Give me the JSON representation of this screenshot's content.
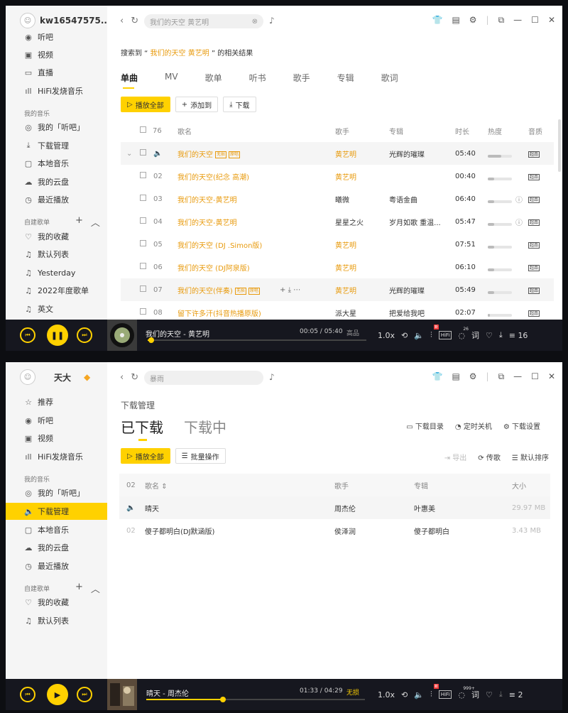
{
  "window1": {
    "user": {
      "name": "kw16547575...",
      "vip_icon": "diamond-icon"
    },
    "search": {
      "value": "我们的天空 黄艺明"
    },
    "sidebar": {
      "top_items": [
        {
          "label": "听吧",
          "icon": "radio-icon"
        },
        {
          "label": "视频",
          "icon": "video-icon"
        },
        {
          "label": "直播",
          "icon": "live-icon"
        },
        {
          "label": "HiFi发烧音乐",
          "icon": "hifi-icon"
        }
      ],
      "my_music_heading": "我的音乐",
      "my_items": [
        {
          "label": "我的「听吧」",
          "icon": "ear-icon"
        },
        {
          "label": "下载管理",
          "icon": "download-icon"
        },
        {
          "label": "本地音乐",
          "icon": "monitor-icon"
        },
        {
          "label": "我的云盘",
          "icon": "cloud-icon"
        },
        {
          "label": "最近播放",
          "icon": "clock-icon"
        }
      ],
      "playlists_heading": "自建歌单",
      "playlists": [
        {
          "label": "我的收藏",
          "icon": "heart-icon"
        },
        {
          "label": "默认列表",
          "icon": "playlist-icon"
        },
        {
          "label": "Yesterday",
          "icon": "playlist-icon"
        },
        {
          "label": "2022年度歌单",
          "icon": "playlist-icon"
        },
        {
          "label": "英文",
          "icon": "playlist-icon"
        }
      ]
    },
    "result": {
      "prefix": "搜索到 “ ",
      "query": "我们的天空 黄艺明",
      "suffix": " ” 的相关结果"
    },
    "tabs": [
      "单曲",
      "MV",
      "歌单",
      "听书",
      "歌手",
      "专辑",
      "歌词"
    ],
    "active_tab": "单曲",
    "buttons": {
      "play_all": "播放全部",
      "add_to": "添加到",
      "download": "下载"
    },
    "table": {
      "count": "76",
      "headers": {
        "song": "歌名",
        "artist": "歌手",
        "album": "专辑",
        "duration": "时长",
        "heat": "热度",
        "quality": "音质"
      },
      "rows": [
        {
          "num": "",
          "title": "我们的天空",
          "tags": [
            "无损",
            "原唱"
          ],
          "artist": "黄艺明",
          "artist_link": true,
          "album": "光辉的璀璨",
          "duration": "05:40",
          "heat": 0.55,
          "playing": true
        },
        {
          "num": "02",
          "title": "我们的天空(纪念 高潮)",
          "tags": [],
          "artist": "黄艺明",
          "artist_link": true,
          "album": "",
          "duration": "00:40",
          "heat": 0.25
        },
        {
          "num": "03",
          "title": "我们的天空-黄艺明",
          "tags": [],
          "artist": "曦微",
          "artist_link": false,
          "album": "粤语金曲",
          "duration": "06:40",
          "heat": 0.25
        },
        {
          "num": "04",
          "title": "我们的天空-黄艺明",
          "tags": [],
          "artist": "星星之火",
          "artist_link": false,
          "album": "岁月如歌 重温...",
          "duration": "05:47",
          "heat": 0.25
        },
        {
          "num": "05",
          "title": "我们的天空 (DJ .Simon版)",
          "tags": [],
          "artist": "黄艺明",
          "artist_link": true,
          "album": "",
          "duration": "07:51",
          "heat": 0.25
        },
        {
          "num": "06",
          "title": "我们的天空 (DJ阿泉版)",
          "tags": [],
          "artist": "黄艺明",
          "artist_link": true,
          "album": "",
          "duration": "06:10",
          "heat": 0.25
        },
        {
          "num": "07",
          "title": "我们的天空(伴奏)",
          "tags": [
            "无损",
            "原唱"
          ],
          "artist": "黄艺明",
          "artist_link": true,
          "album": "光辉的璀璨",
          "duration": "05:49",
          "heat": 0.25,
          "hover": true
        },
        {
          "num": "08",
          "title": "留下许多汗(抖音热播原版)",
          "tags": [],
          "artist": "派大星",
          "artist_link": false,
          "album": "把爱给我吧",
          "duration": "02:07",
          "heat": 0.1
        }
      ],
      "quality_label": "超品"
    },
    "player": {
      "title": "我们的天空 - 黄艺明",
      "time": "00:05 / 05:40",
      "quality": "高品",
      "speed": "1.0x",
      "progress": 0.015,
      "comments": "26",
      "queue_count": "16",
      "hifi": "HiFi",
      "lyric": "词",
      "new_label": "新"
    }
  },
  "window2": {
    "user": {
      "name": "天大",
      "vip_icon": "diamond-icon"
    },
    "search": {
      "placeholder": "暴雨"
    },
    "sidebar": {
      "top_items": [
        {
          "label": "推荐",
          "icon": "star-icon"
        },
        {
          "label": "听吧",
          "icon": "radio-icon"
        },
        {
          "label": "视频",
          "icon": "video-icon"
        },
        {
          "label": "HiFi发烧音乐",
          "icon": "hifi-icon"
        }
      ],
      "my_music_heading": "我的音乐",
      "my_items": [
        {
          "label": "我的「听吧」",
          "icon": "ear-icon"
        },
        {
          "label": "下载管理",
          "icon": "speaker-icon"
        },
        {
          "label": "本地音乐",
          "icon": "monitor-icon"
        },
        {
          "label": "我的云盘",
          "icon": "cloud-icon"
        },
        {
          "label": "最近播放",
          "icon": "clock-icon"
        }
      ],
      "playlists_heading": "自建歌单",
      "playlists": [
        {
          "label": "我的收藏",
          "icon": "heart-icon"
        },
        {
          "label": "默认列表",
          "icon": "playlist-icon"
        }
      ]
    },
    "page_title": "下载管理",
    "tabs": {
      "downloaded": "已下载",
      "downloading": "下载中"
    },
    "links": {
      "dir": "下载目录",
      "shutdown": "定时关机",
      "settings": "下载设置"
    },
    "buttons": {
      "play_all": "播放全部",
      "batch": "批量操作"
    },
    "tools": {
      "export": "导出",
      "transfer": "传歌",
      "sort": "默认排序"
    },
    "table": {
      "count": "02",
      "headers": {
        "song": "歌名",
        "artist": "歌手",
        "album": "专辑",
        "size": "大小"
      },
      "rows": [
        {
          "num": "",
          "title": "晴天",
          "artist": "周杰伦",
          "album": "叶惠美",
          "size": "29.97 MB",
          "playing": true
        },
        {
          "num": "02",
          "title": "傻子都明白(DJ默涵版)",
          "artist": "侯泽润",
          "album": "傻子都明白",
          "size": "3.43 MB"
        }
      ]
    },
    "player": {
      "title": "晴天 - 周杰伦",
      "time": "01:33 / 04:29",
      "quality": "无损",
      "speed": "1.0x",
      "progress": 0.35,
      "comments": "999+",
      "queue_count": "2",
      "hifi": "HiFi",
      "lyric": "词",
      "new_label": "新"
    }
  },
  "colors": {
    "accent": "#ffd100",
    "song_link": "#e89a0c",
    "player_bg": "#16171f"
  }
}
